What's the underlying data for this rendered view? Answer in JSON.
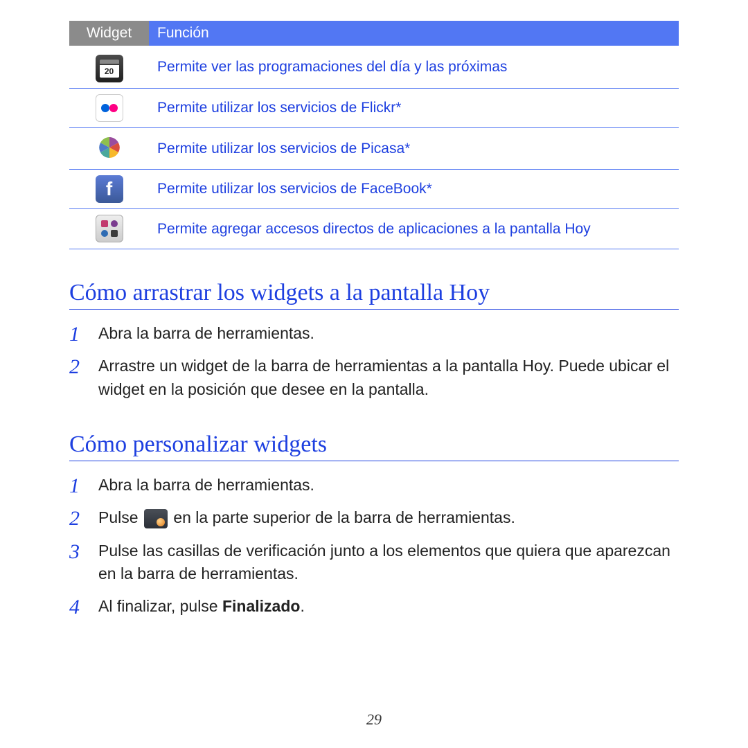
{
  "table": {
    "headers": {
      "widget": "Widget",
      "funcion": "Función"
    },
    "rows": [
      {
        "icon": "calendar",
        "desc": "Permite ver las programaciones del día y las próximas"
      },
      {
        "icon": "flickr",
        "desc": "Permite utilizar los servicios de Flickr*"
      },
      {
        "icon": "picasa",
        "desc": "Permite utilizar los servicios de Picasa*"
      },
      {
        "icon": "facebook",
        "desc": "Permite utilizar los servicios de FaceBook*"
      },
      {
        "icon": "shortcuts",
        "desc": "Permite agregar accesos directos de aplicaciones a la pantalla Hoy"
      }
    ]
  },
  "section1": {
    "title": "Cómo arrastrar los widgets a la pantalla Hoy",
    "steps": [
      "Abra la barra de herramientas.",
      "Arrastre un widget de la barra de herramientas a la pantalla Hoy. Puede ubicar el widget en la posición que desee en la pantalla."
    ]
  },
  "section2": {
    "title": "Cómo personalizar widgets",
    "steps": {
      "s1": "Abra la barra de herramientas.",
      "s2a": "Pulse ",
      "s2b": " en la parte superior de la barra de herramientas.",
      "s3": "Pulse las casillas de verificación junto a los elementos que quiera que aparezcan en la barra de herramientas.",
      "s4a": "Al finalizar, pulse ",
      "s4b": "Finalizado",
      "s4c": "."
    }
  },
  "page_number": "29"
}
